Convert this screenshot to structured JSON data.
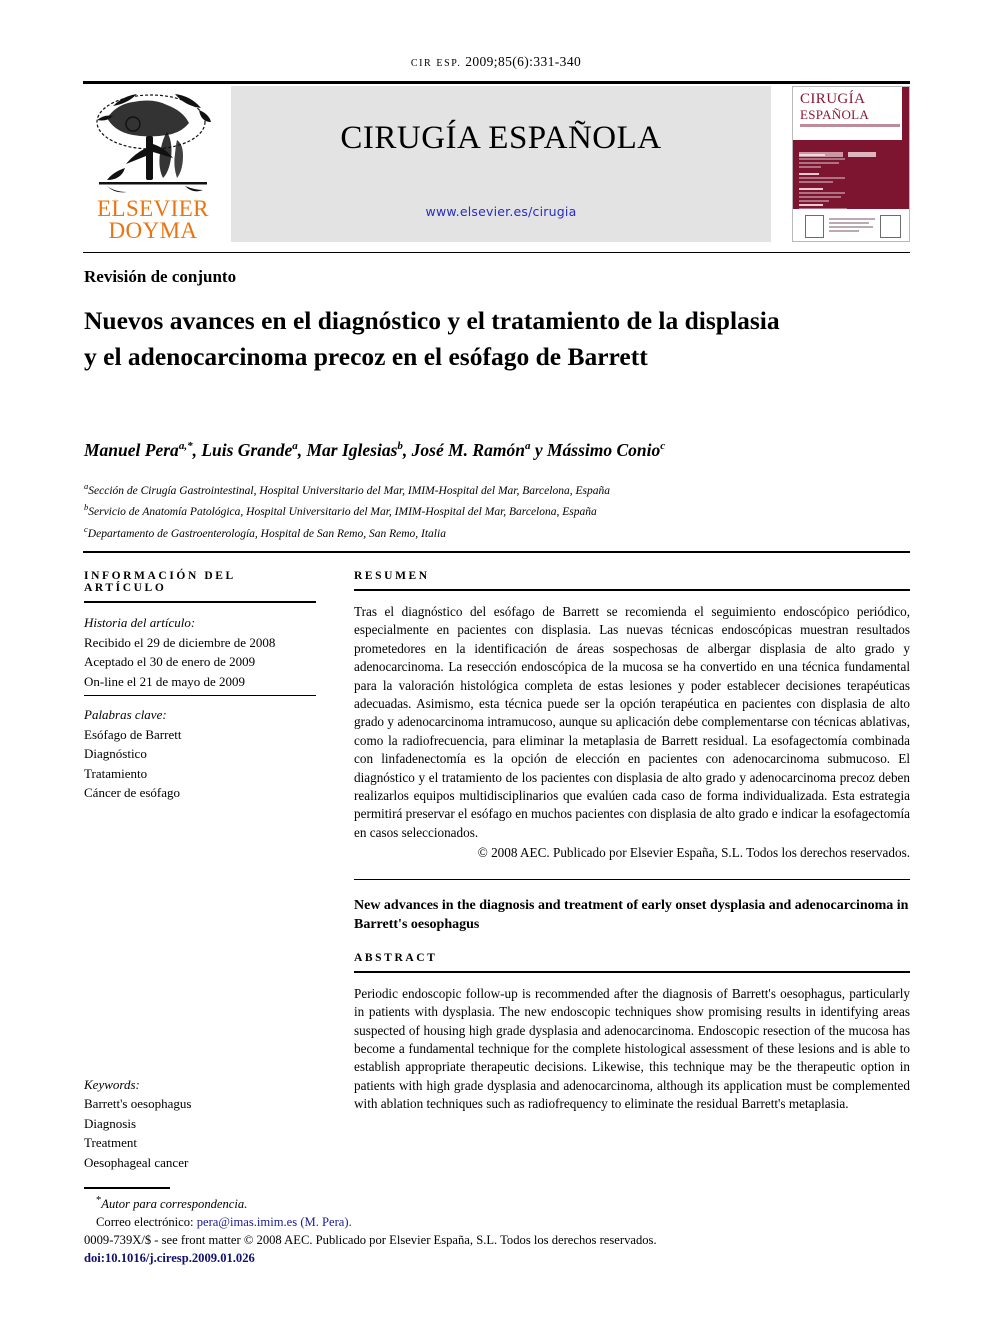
{
  "running_head": {
    "journal_abbrev": "CIR ESP.",
    "citation": "2009;85(6):331-340"
  },
  "masthead": {
    "publisher_logo": "elsevier-doyma-tree-logo",
    "publisher_line1": "ELSEVIER",
    "publisher_line2": "DOYMA",
    "journal_title": "CIRUGÍA ESPAÑOLA",
    "journal_url": "www.elsevier.es/cirugia",
    "cover": {
      "title_line1": "CIRUGÍA",
      "title_line2": "ESPAÑOLA",
      "accent_color": "#7d1430"
    }
  },
  "article": {
    "section_label": "Revisión de conjunto",
    "title": "Nuevos avances en el diagnóstico y el tratamiento de la displasia y el adenocarcinoma precoz en el esófago de Barrett",
    "authors_html": "Manuel Pera<sup>a,*</sup>, Luis Grande<sup>a</sup>, Mar Iglesias<sup>b</sup>, José M. Ramón<sup>a</sup> y Mássimo Conio<sup>c</sup>",
    "affiliations": [
      {
        "marker": "a",
        "text": "Sección de Cirugía Gastrointestinal, Hospital Universitario del Mar, IMIM-Hospital del Mar, Barcelona, España"
      },
      {
        "marker": "b",
        "text": "Servicio de Anatomía Patológica, Hospital Universitario del Mar, IMIM-Hospital del Mar, Barcelona, España"
      },
      {
        "marker": "c",
        "text": "Departamento de Gastroenterología, Hospital de San Remo, San Remo, Italia"
      }
    ]
  },
  "info_panel": {
    "heading": "INFORMACIÓN DEL ARTÍCULO",
    "history_label": "Historia del artículo:",
    "history": [
      "Recibido el 29 de diciembre de 2008",
      "Aceptado el 30 de enero de 2009",
      "On-line el 21 de mayo de 2009"
    ],
    "keywords_label": "Palabras clave:",
    "keywords": [
      "Esófago de Barrett",
      "Diagnóstico",
      "Tratamiento",
      "Cáncer de esófago"
    ],
    "en_keywords_label": "Keywords:",
    "en_keywords": [
      "Barrett's oesophagus",
      "Diagnosis",
      "Treatment",
      "Oesophageal cancer"
    ]
  },
  "abstract_es": {
    "heading": "RESUMEN",
    "body": "Tras el diagnóstico del esófago de Barrett se recomienda el seguimiento endoscópico periódico, especialmente en pacientes con displasia. Las nuevas técnicas endoscópicas muestran resultados prometedores en la identificación de áreas sospechosas de albergar displasia de alto grado y adenocarcinoma. La resección endoscópica de la mucosa se ha convertido en una técnica fundamental para la valoración histológica completa de estas lesiones y poder establecer decisiones terapéuticas adecuadas. Asimismo, esta técnica puede ser la opción terapéutica en pacientes con displasia de alto grado y adenocarcinoma intramucoso, aunque su aplicación debe complementarse con técnicas ablativas, como la radiofrecuencia, para eliminar la metaplasia de Barrett residual. La esofagectomía combinada con linfadenectomía es la opción de elección en pacientes con adenocarcinoma submucoso. El diagnóstico y el tratamiento de los pacientes con displasia de alto grado y adenocarcinoma precoz deben realizarlos equipos multidisciplinarios que evalúen cada caso de forma individualizada. Esta estrategia permitirá preservar el esófago en muchos pacientes con displasia de alto grado e indicar la esofagectomía en casos seleccionados.",
    "copyright": "© 2008 AEC. Publicado por Elsevier España, S.L. Todos los derechos reservados."
  },
  "abstract_en": {
    "title": "New advances in the diagnosis and treatment of early onset dysplasia and adenocarcinoma in Barrett's oesophagus",
    "heading": "ABSTRACT",
    "body": "Periodic endoscopic follow-up is recommended after the diagnosis of Barrett's oesophagus, particularly in patients with dysplasia. The new endoscopic techniques show promising results in identifying areas suspected of housing high grade dysplasia and adenocarcinoma. Endoscopic resection of the mucosa has become a fundamental technique for the complete histological assessment of these lesions and is able to establish appropriate therapeutic decisions. Likewise, this technique may be the therapeutic option in patients with high grade dysplasia and adenocarcinoma, although its application must be complemented with ablation techniques such as radiofrequency to eliminate the residual Barrett's metaplasia."
  },
  "footer": {
    "corresponding_marker": "*",
    "corresponding_label": "Autor para correspondencia.",
    "email_label": "Correo electrónico:",
    "email": "pera@imas.imim.es",
    "email_author": "(M. Pera).",
    "issn_line": "0009-739X/$ - see front matter © 2008 AEC. Publicado por Elsevier España, S.L. Todos los derechos reservados.",
    "doi": "doi:10.1016/j.ciresp.2009.01.026"
  }
}
